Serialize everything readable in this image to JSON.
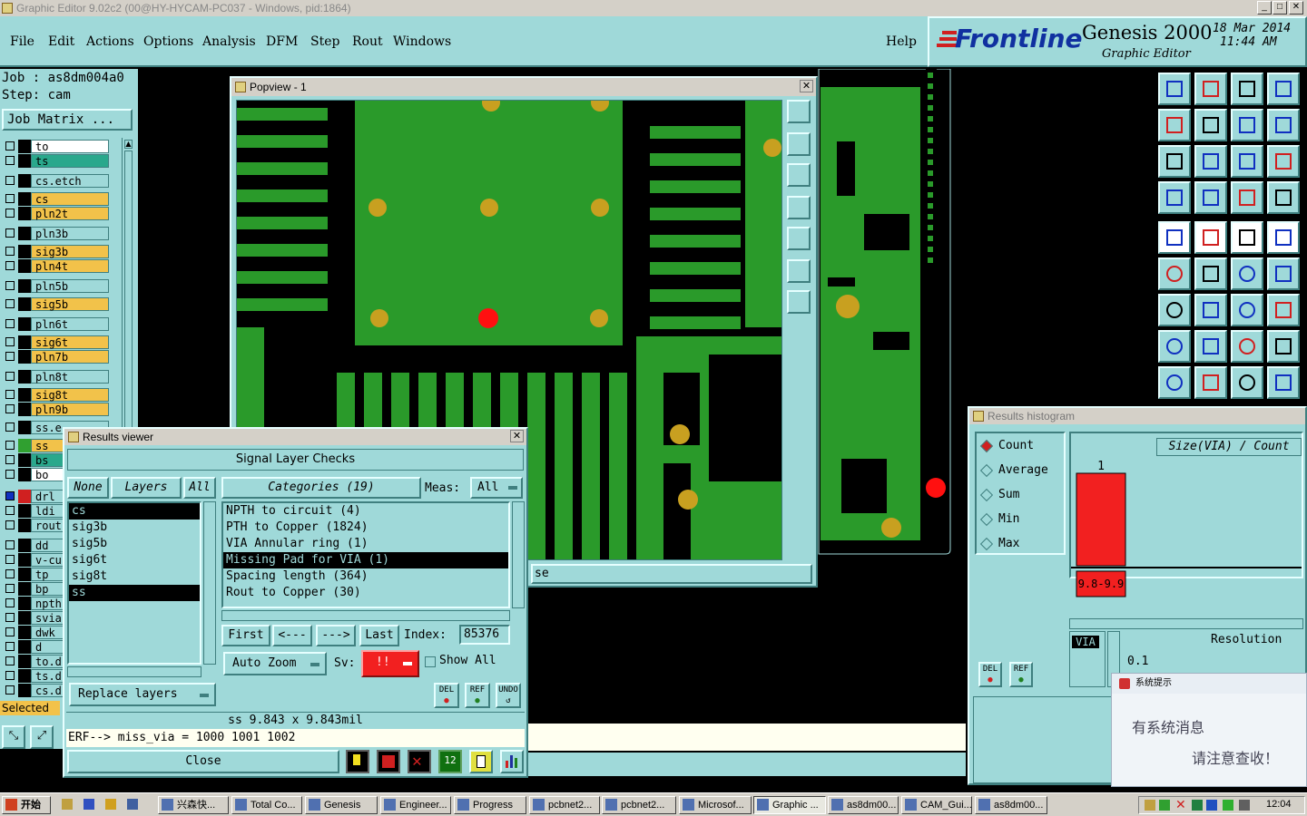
{
  "window": {
    "title": "Graphic Editor 9.02c2 (00@HY-HYCAM-PC037 - Windows, pid:1864)"
  },
  "menu": {
    "items": [
      "File",
      "Edit",
      "Actions",
      "Options",
      "Analysis",
      "DFM",
      "Step",
      "Rout",
      "Windows"
    ],
    "help": "Help"
  },
  "logo": {
    "brand": "Frontline",
    "product": "Genesis 2000",
    "subtitle": "Graphic Editor",
    "date": "18 Mar 2014",
    "time": "11:44 AM"
  },
  "job": {
    "job_label": "Job : as8dm004a0",
    "step_label": "Step: cam",
    "matrix_button": "Job Matrix ..."
  },
  "layers": [
    {
      "name": "to",
      "color": "#ffffff"
    },
    {
      "name": "ts",
      "color": "#2aa88c"
    },
    {
      "name": "cs.etch",
      "color": "#9fd9d9"
    },
    {
      "name": "cs",
      "color": "#f2c24a"
    },
    {
      "name": "pln2t",
      "color": "#f2c24a"
    },
    {
      "name": "pln3b",
      "color": "#9fd9d9"
    },
    {
      "name": "sig3b",
      "color": "#f2c24a"
    },
    {
      "name": "pln4t",
      "color": "#f2c24a"
    },
    {
      "name": "pln5b",
      "color": "#9fd9d9"
    },
    {
      "name": "sig5b",
      "color": "#f2c24a"
    },
    {
      "name": "pln6t",
      "color": "#9fd9d9"
    },
    {
      "name": "sig6t",
      "color": "#f2c24a"
    },
    {
      "name": "pln7b",
      "color": "#f2c24a"
    },
    {
      "name": "pln8t",
      "color": "#9fd9d9"
    },
    {
      "name": "sig8t",
      "color": "#f2c24a"
    },
    {
      "name": "pln9b",
      "color": "#f2c24a"
    },
    {
      "name": "ss.e",
      "color": "#9fd9d9"
    },
    {
      "name": "ss",
      "color": "#f2c24a"
    },
    {
      "name": "bs",
      "color": "#2aa88c"
    },
    {
      "name": "bo",
      "color": "#ffffff"
    },
    {
      "name": "drl",
      "color": "#9fd9d9"
    },
    {
      "name": "ldi",
      "color": "#9fd9d9"
    },
    {
      "name": "rout",
      "color": "#9fd9d9"
    },
    {
      "name": "dd",
      "color": "#9fd9d9"
    },
    {
      "name": "v-cu",
      "color": "#9fd9d9"
    },
    {
      "name": "tp",
      "color": "#9fd9d9"
    },
    {
      "name": "bp",
      "color": "#9fd9d9"
    },
    {
      "name": "npth",
      "color": "#9fd9d9"
    },
    {
      "name": "svia",
      "color": "#9fd9d9"
    },
    {
      "name": "dwk",
      "color": "#9fd9d9"
    },
    {
      "name": "d",
      "color": "#9fd9d9"
    },
    {
      "name": "to.d",
      "color": "#9fd9d9"
    },
    {
      "name": "ts.d",
      "color": "#9fd9d9"
    },
    {
      "name": "cs.d",
      "color": "#9fd9d9"
    }
  ],
  "selected_label": "Selected",
  "popview": {
    "title": "Popview - 1",
    "behind_button": "se"
  },
  "results_viewer": {
    "title": "Results viewer",
    "heading": "Signal Layer Checks",
    "none_btn": "None",
    "layers_btn": "Layers",
    "all_btn": "All",
    "layers": [
      "cs",
      "sig3b",
      "sig5b",
      "sig6t",
      "sig8t",
      "ss"
    ],
    "categories_label": "Categories (19)",
    "meas_label": "Meas:",
    "meas_value": "All",
    "categories": [
      "NPTH to circuit (4)",
      "PTH to Copper (1824)",
      "VIA Annular ring (1)",
      "Missing Pad for VIA (1)",
      "Spacing length (364)",
      "Rout to Copper (30)"
    ],
    "first": "First",
    "prev": "<---",
    "next": "--->",
    "last": "Last",
    "index_label": "Index:",
    "index_value": "85376",
    "auto_zoom": "Auto Zoom",
    "sv_label": "Sv:",
    "sv_value": "!!",
    "show_all": "Show All",
    "replace_layers": "Replace layers",
    "del": "DEL",
    "ref": "REF",
    "undo": "UNDO",
    "status": "ss 9.843 x 9.843mil",
    "erf": "ERF--> miss_via = 1000 1001 1002",
    "close": "Close"
  },
  "histogram": {
    "title": "Results histogram",
    "modes": [
      "Count",
      "Average",
      "Sum",
      "Min",
      "Max"
    ],
    "selected_mode": "Count",
    "axis_label": "Size(VIA) / Count",
    "resolution_label": "Resolution",
    "resolution_value": "0.1",
    "via_tag": "VIA",
    "del": "DEL",
    "ref": "REF",
    "bar_color": "#f22020",
    "chart_data": {
      "type": "bar",
      "categories": [
        "9.8-9.9"
      ],
      "values": [
        1
      ]
    }
  },
  "notification": {
    "title": "系统提示",
    "line1": "有系统消息",
    "line2": "请注意查收！"
  },
  "taskbar": {
    "start": "开始",
    "items": [
      "兴森快...",
      "Total Co...",
      "Genesis",
      "Engineer...",
      "Progress",
      "pcbnet2...",
      "pcbnet2...",
      "Microsof...",
      "Graphic ...",
      "as8dm00...",
      "CAM_Gui...",
      "as8dm00..."
    ],
    "clock": "12:04"
  },
  "colors": {
    "panel": "#9fd9d9",
    "copper": "#2a9a2a",
    "pad": "#c8a020",
    "highlight": "#ff1010"
  }
}
